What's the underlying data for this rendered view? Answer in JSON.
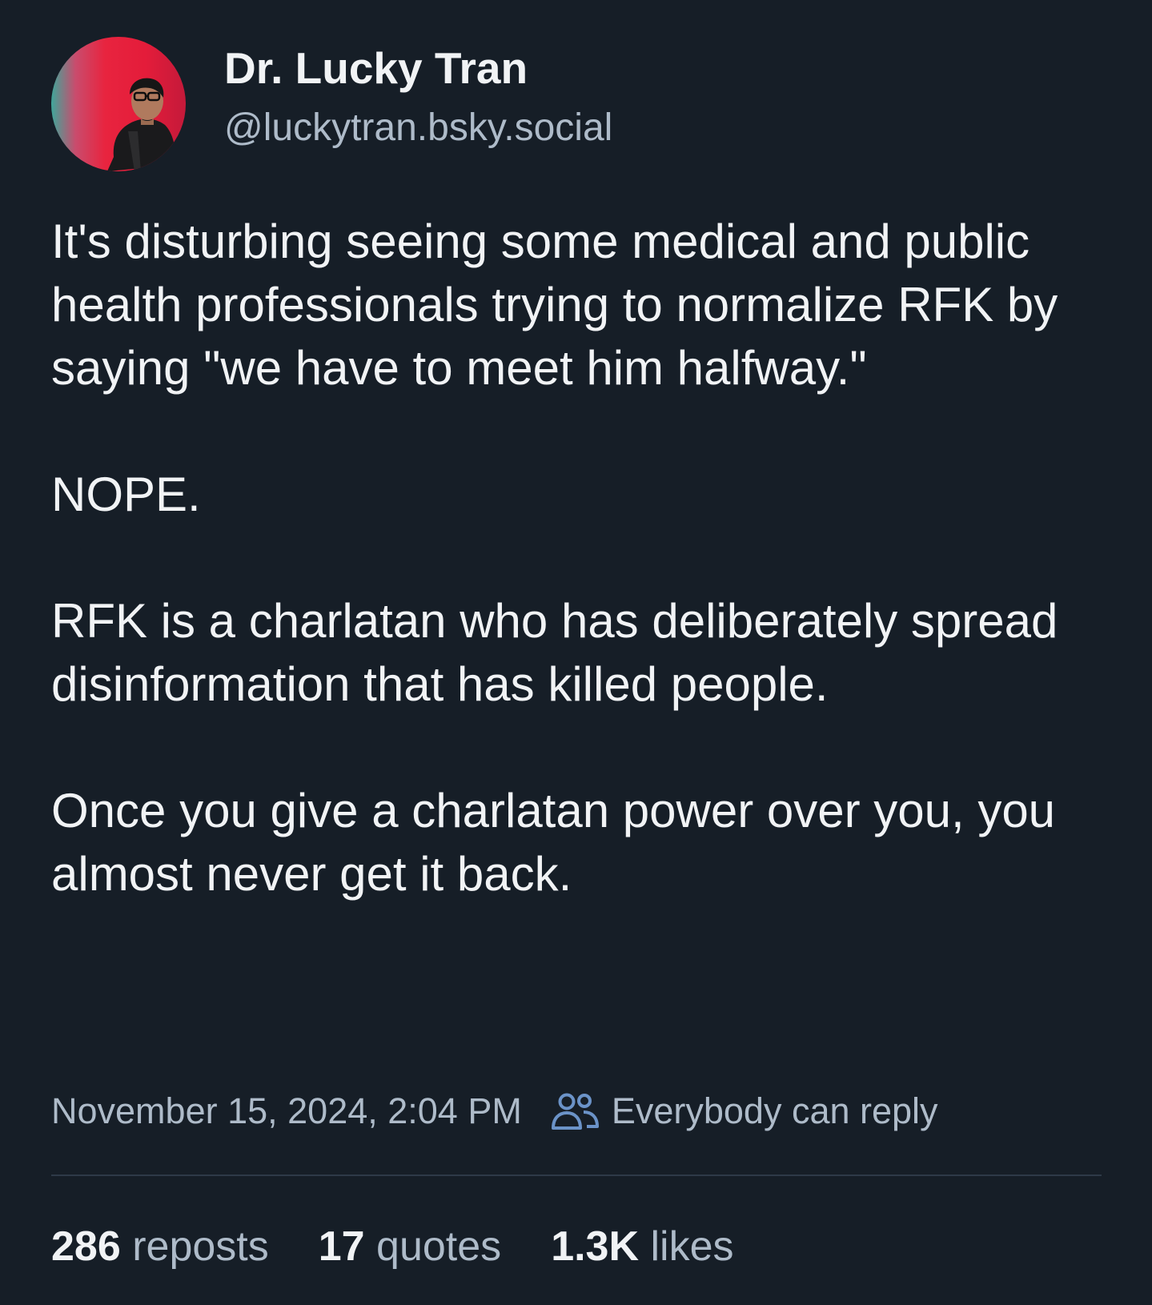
{
  "author": {
    "display_name": "Dr. Lucky Tran",
    "handle": "@luckytran.bsky.social",
    "avatar_icon": "profile-photo"
  },
  "post": {
    "paragraphs": [
      "It's disturbing seeing some medical and public health professionals trying to normalize RFK by saying \"we have to meet him halfway.\"",
      "NOPE.",
      "RFK is a charlatan who has deliberately spread disinformation that has killed people.",
      "Once you give a charlatan power over you, you almost never get it back."
    ],
    "timestamp": "November 15, 2024, 2:04 PM",
    "reply_setting": "Everybody can reply",
    "reply_icon": "people-icon"
  },
  "stats": {
    "reposts_count": "286",
    "reposts_label": "reposts",
    "quotes_count": "17",
    "quotes_label": "quotes",
    "likes_count": "1.3K",
    "likes_label": "likes"
  },
  "colors": {
    "background": "#161e27",
    "text_primary": "#f1f3f5",
    "text_secondary": "#aebbc9",
    "divider": "#2e3a48",
    "reply_icon": "#6b93c8"
  }
}
